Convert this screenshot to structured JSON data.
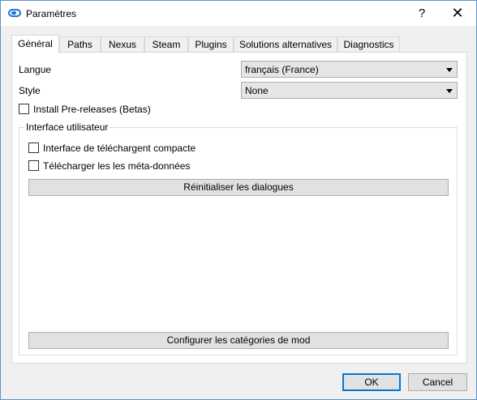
{
  "window": {
    "title": "Paramètres",
    "help_glyph": "?",
    "close_glyph": "✕"
  },
  "tabs": [
    {
      "label": "Général",
      "active": true
    },
    {
      "label": "Paths"
    },
    {
      "label": "Nexus"
    },
    {
      "label": "Steam"
    },
    {
      "label": "Plugins"
    },
    {
      "label": "Solutions alternatives"
    },
    {
      "label": "Diagnostics"
    }
  ],
  "general": {
    "language": {
      "label": "Langue",
      "value": "français (France)"
    },
    "style": {
      "label": "Style",
      "value": "None"
    },
    "prereleases": {
      "label": "Install Pre-releases (Betas)",
      "checked": false
    },
    "ui_group": {
      "title": "Interface utilisateur",
      "compact": {
        "label": "Interface de téléchargent compacte",
        "checked": false
      },
      "metadata": {
        "label": "Télécharger les les méta-données",
        "checked": false
      },
      "reset_dialogs": "Réinitialiser les dialogues",
      "configure_categories": "Configurer les catégories de mod"
    }
  },
  "footer": {
    "ok": "OK",
    "cancel": "Cancel"
  },
  "colors": {
    "accent": "#0078d7",
    "icon": "#1a74d6"
  }
}
